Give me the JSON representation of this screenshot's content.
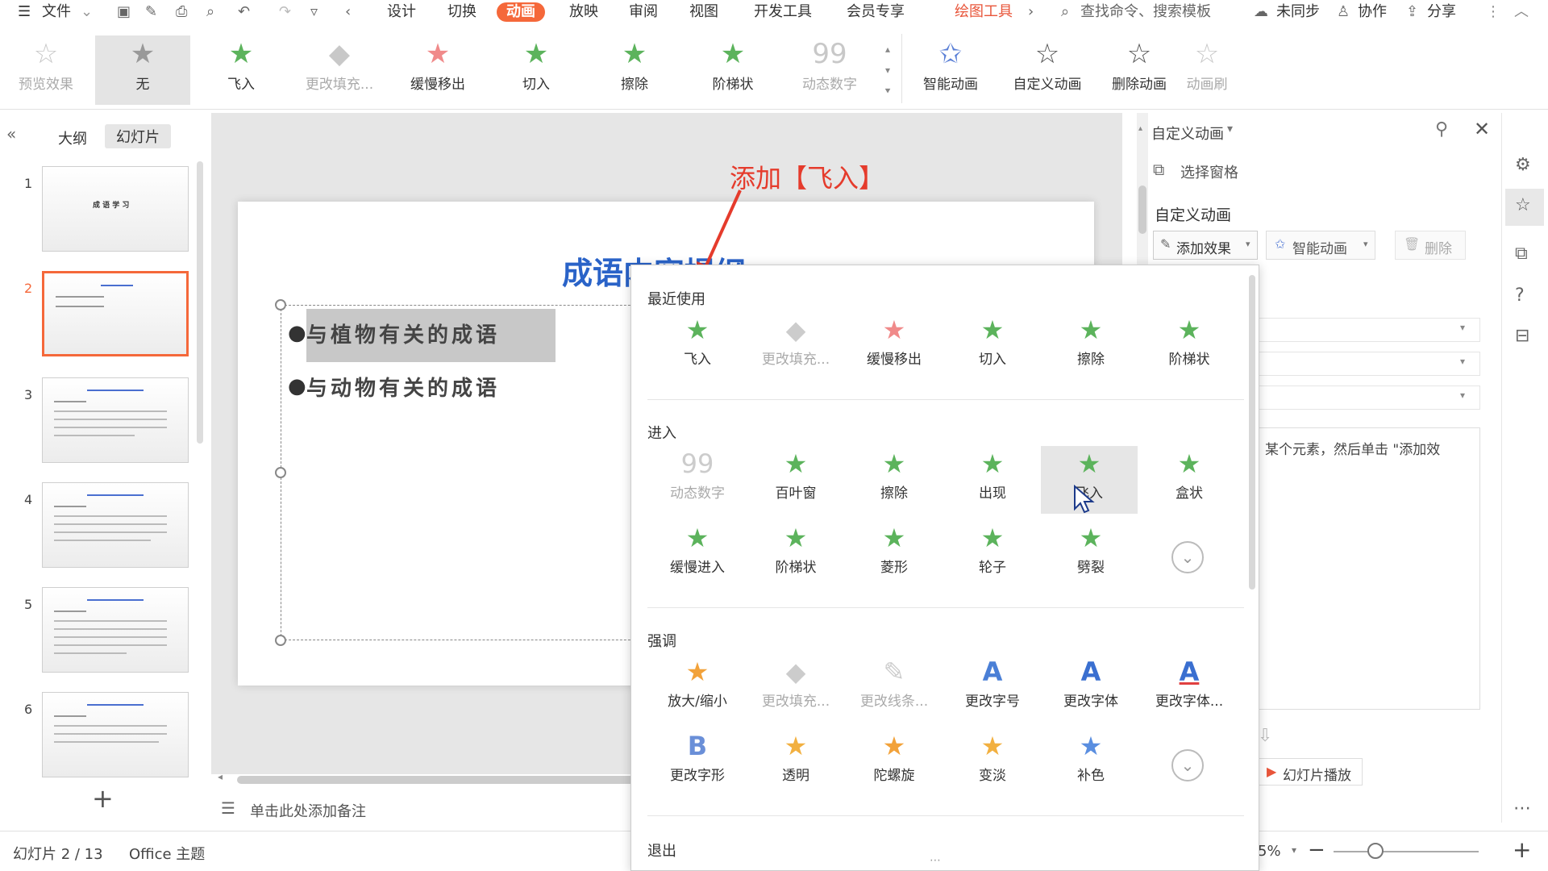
{
  "menubar": {
    "file": "文件",
    "tabs": [
      "设计",
      "切换",
      "动画",
      "放映",
      "审阅",
      "视图",
      "开发工具",
      "会员专享"
    ],
    "drawing_tools": "绘图工具",
    "search": "查找命令、搜索模板",
    "unsynced": "未同步",
    "collab": "协作",
    "share": "分享"
  },
  "ribbon": {
    "preview": "预览效果",
    "none": "无",
    "effects": [
      "飞入",
      "更改填充...",
      "缓慢移出",
      "切入",
      "擦除",
      "阶梯状",
      "动态数字"
    ],
    "smart": "智能动画",
    "custom": "自定义动画",
    "delete": "删除动画",
    "brush": "动画刷"
  },
  "leftpane": {
    "tab_outline": "大纲",
    "tab_slides": "幻灯片",
    "slide_numbers": [
      "1",
      "2",
      "3",
      "4",
      "5",
      "6"
    ],
    "slide1_title": "成 语 学 习"
  },
  "slide": {
    "title": "成语内容提纲",
    "bullets": [
      "与植物有关的成语",
      "与动物有关的成语"
    ]
  },
  "annotation": "添加【飞入】",
  "notes_placeholder": "单击此处添加备注",
  "dropdown": {
    "recent_title": "最近使用",
    "recent": [
      "飞入",
      "更改填充...",
      "缓慢移出",
      "切入",
      "擦除",
      "阶梯状"
    ],
    "enter_title": "进入",
    "enter": [
      "动态数字",
      "百叶窗",
      "擦除",
      "出现",
      "飞入",
      "盒状",
      "缓慢进入",
      "阶梯状",
      "菱形",
      "轮子",
      "劈裂"
    ],
    "emph_title": "强调",
    "emph": [
      "放大/缩小",
      "更改填充...",
      "更改线条...",
      "更改字号",
      "更改字体",
      "更改字体...",
      "更改字形",
      "透明",
      "陀螺旋",
      "变淡",
      "补色"
    ],
    "exit_title": "退出"
  },
  "rightpanel": {
    "header": "自定义动画",
    "select_pane": "选择窗格",
    "section": "自定义动画",
    "add_effect": "添加效果",
    "smart": "智能动画",
    "delete": "删除",
    "hint": "某个元素，然后单击 \"添加效",
    "play": "幻灯片播放"
  },
  "statusbar": {
    "slide_info": "幻灯片 2 / 13",
    "theme": "Office 主题",
    "zoom": "5%"
  }
}
